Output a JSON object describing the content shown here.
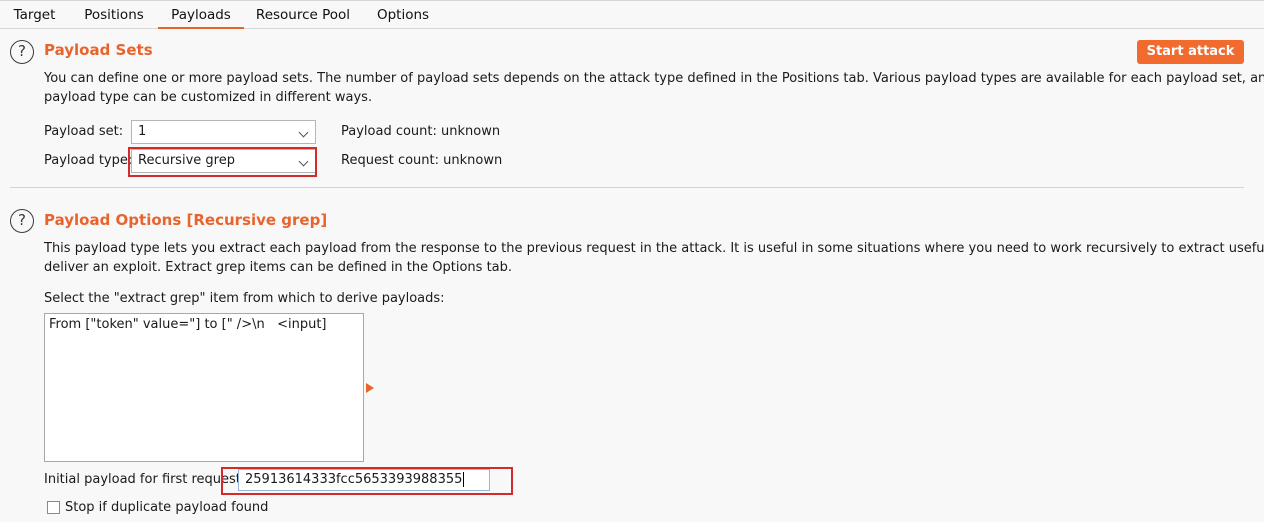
{
  "tabs": [
    "Target",
    "Positions",
    "Payloads",
    "Resource Pool",
    "Options"
  ],
  "active_tab": "Payloads",
  "payload_sets": {
    "title": "Payload Sets",
    "help_icon": "question-circle-icon",
    "start_attack_label": "Start attack",
    "description_line1": "You can define one or more payload sets. The number of payload sets depends on the attack type defined in the Positions tab. Various payload types are available for each payload set, and each",
    "description_line2": "payload type can be customized in different ways.",
    "payload_set_label": "Payload set:",
    "payload_set_value": "1",
    "payload_type_label": "Payload type:",
    "payload_type_value": "Recursive grep",
    "payload_count_label": "Payload count:",
    "payload_count_value": "unknown",
    "request_count_label": "Request count:",
    "request_count_value": "unknown"
  },
  "payload_options": {
    "title": "Payload Options [Recursive grep]",
    "help_icon": "question-circle-icon",
    "description_line1": "This payload type lets you extract each payload from the response to the previous request in the attack. It is useful in some situations where you need to work recursively to extract useful data or",
    "description_line2": "deliver an exploit. Extract grep items can be defined in the Options tab.",
    "select_label": "Select the \"extract grep\" item from which to derive payloads:",
    "grep_items": [
      "From [\"token\" value=\"] to [\" />\\n   <input]"
    ],
    "initial_payload_label": "Initial payload for first request:",
    "initial_payload_value": "25913614333fcc5653393988355",
    "stop_duplicate_label": "Stop if duplicate payload found",
    "stop_duplicate_checked": false
  },
  "colors": {
    "accent": "#e8642d",
    "highlight_box": "#d42a2a"
  }
}
